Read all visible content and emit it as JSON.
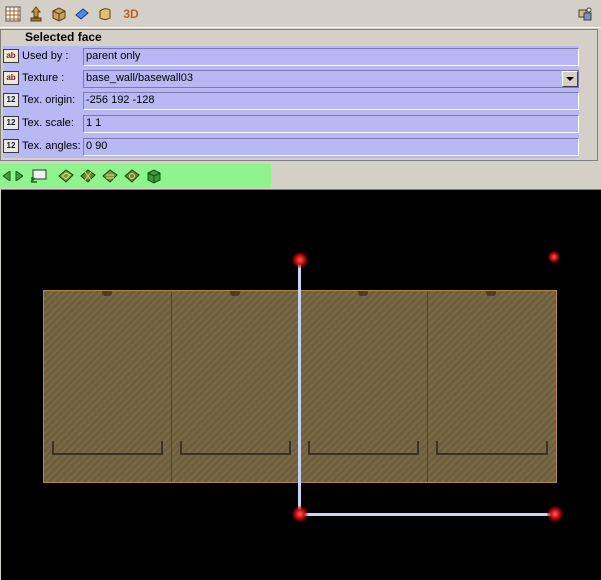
{
  "toolbar": {
    "icons": [
      "grid-icon",
      "entity-icon",
      "brush-icon",
      "face-icon",
      "patch-icon",
      "3d-view-icon",
      "settings-icon"
    ],
    "label_3d": "3D"
  },
  "panel": {
    "title": "Selected face",
    "rows": [
      {
        "type_icon": "ab",
        "label": "Used by :",
        "value": "parent only"
      },
      {
        "type_icon": "ab",
        "label": "Texture :",
        "value": "base_wall/basewall03"
      },
      {
        "type_icon": "12",
        "label": "Tex. origin:",
        "value": "-256 192 -128"
      },
      {
        "type_icon": "12",
        "label": "Tex. scale:",
        "value": "1 1"
      },
      {
        "type_icon": "12",
        "label": "Tex. angles:",
        "value": "0 90"
      }
    ]
  },
  "toolbar2": {
    "icons": [
      "prev-arrow-icon",
      "next-arrow-icon",
      "apply-icon",
      "texture-op-1-icon",
      "texture-op-2-icon",
      "texture-op-3-icon",
      "texture-op-4-icon",
      "cube-icon"
    ]
  },
  "colors": {
    "panel_bg": "#d4d0c8",
    "property_bg": "#b8b8f4",
    "toolbar2_bg": "#8ef58e",
    "viewport_bg": "#000000",
    "axis": "#c8d4f4",
    "handle": "#e02020"
  }
}
